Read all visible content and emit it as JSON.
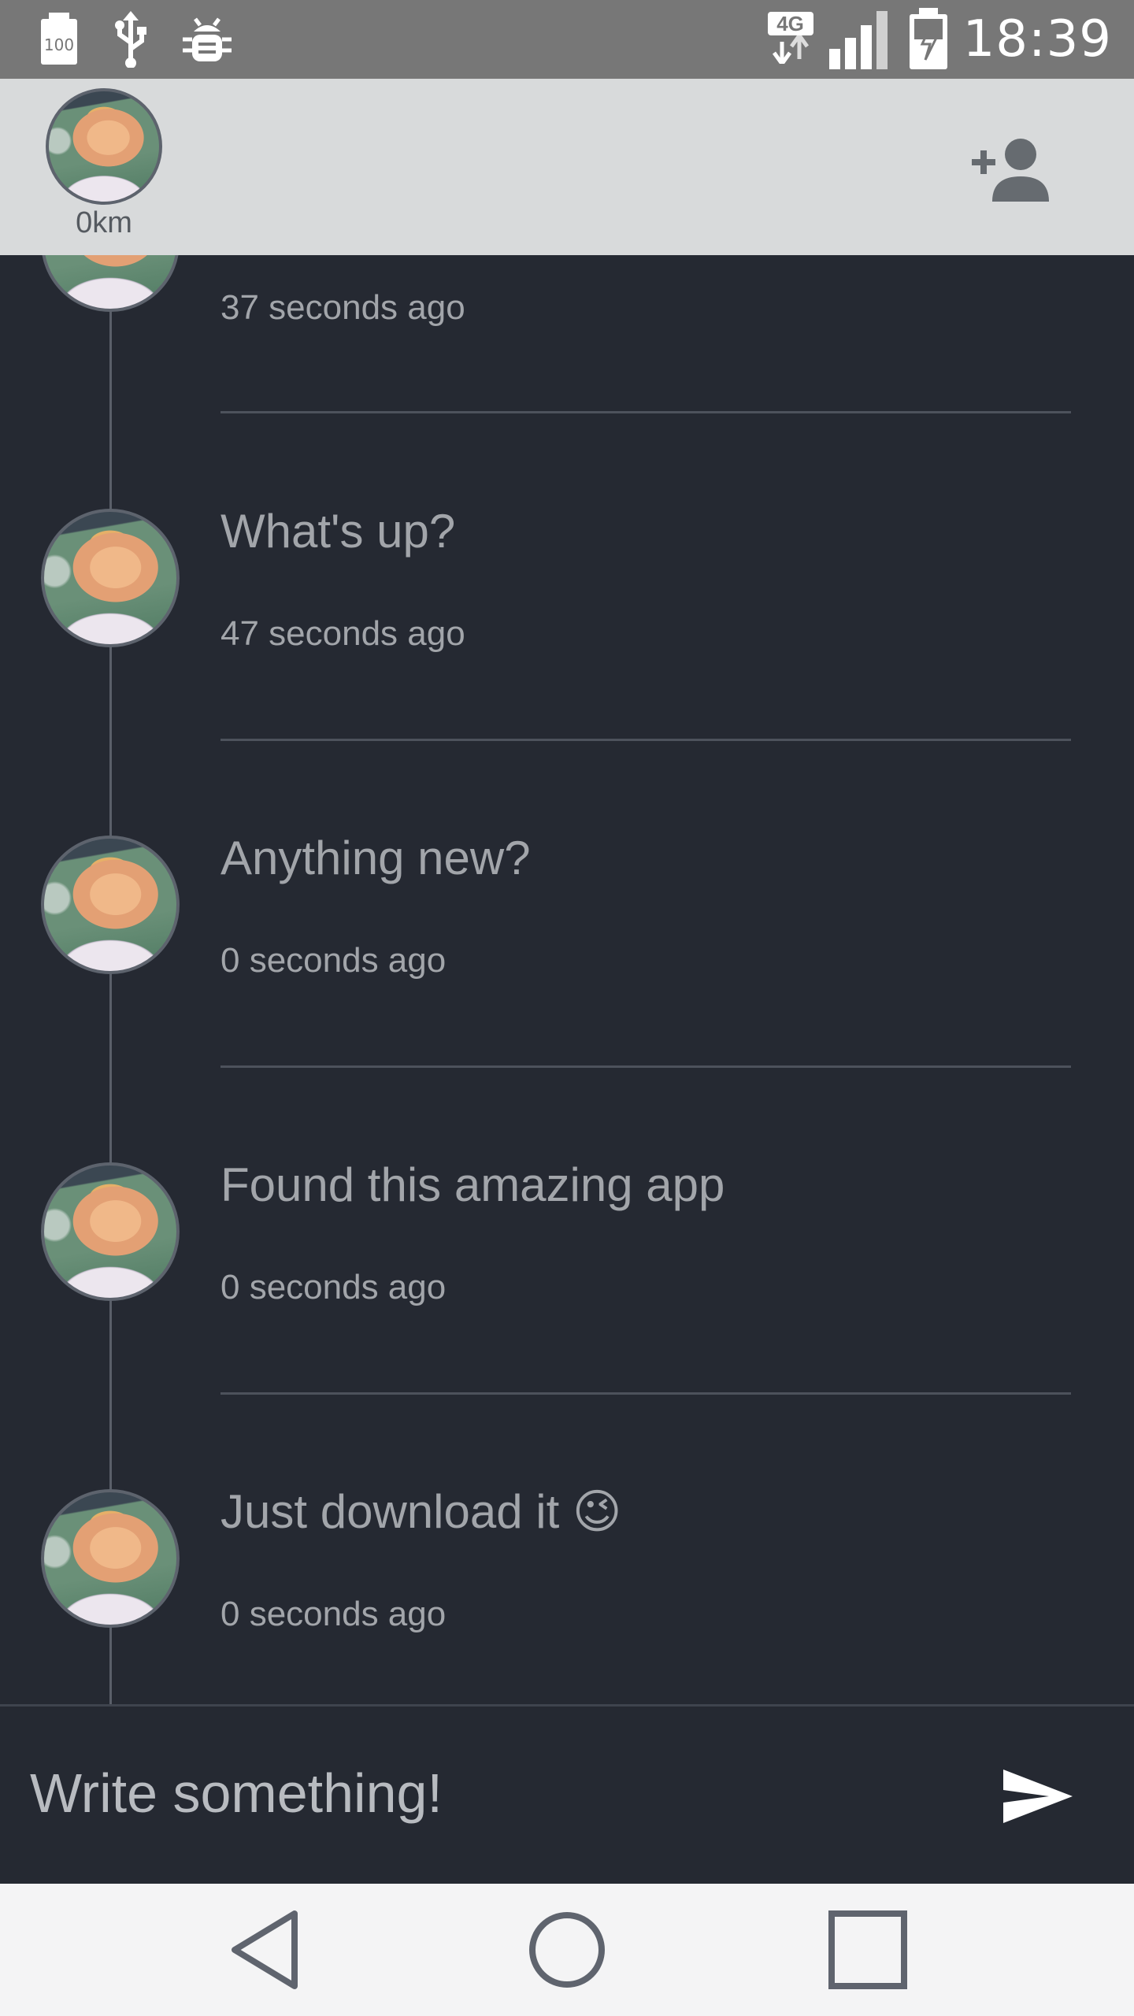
{
  "status_bar": {
    "battery_level_label": "100",
    "network_type": "4G",
    "time": "18:39"
  },
  "header": {
    "distance": "0km",
    "icons": {
      "avatar": "profile-avatar",
      "add_user": "add-person-icon"
    }
  },
  "messages": [
    {
      "text": "",
      "time": "37 seconds ago"
    },
    {
      "text": "What's up?",
      "time": "47 seconds ago"
    },
    {
      "text": "Anything new?",
      "time": "0 seconds ago"
    },
    {
      "text": "Found this amazing app",
      "time": "0 seconds ago"
    },
    {
      "text": "Just download it 😉",
      "time": "0 seconds ago"
    }
  ],
  "composer": {
    "placeholder": "Write something!",
    "send_icon": "send-icon"
  },
  "nav": {
    "back_icon": "back-triangle-icon",
    "home_icon": "home-circle-icon",
    "recents_icon": "recents-square-icon"
  },
  "colors": {
    "status_bar": "#777777",
    "header": "#d8dadb",
    "background": "#252932",
    "text": "#a2a5aa",
    "nav_bar": "#f4f4f5"
  }
}
